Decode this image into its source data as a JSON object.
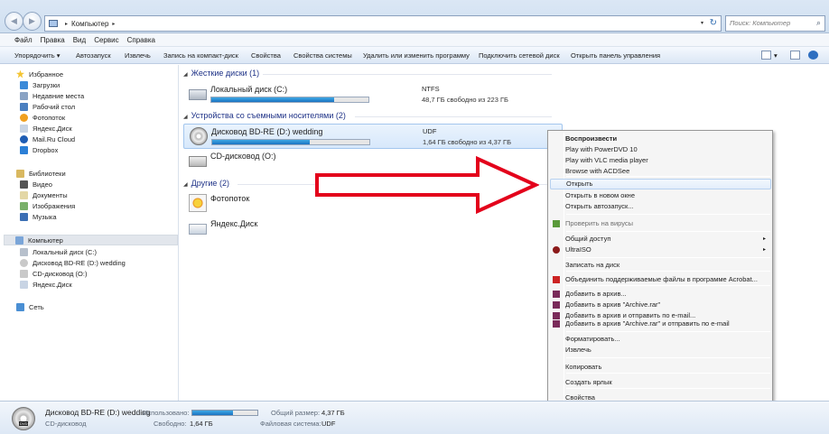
{
  "window": {
    "address": {
      "root_glyph": "▸",
      "crumb": "Компьютер",
      "dropdown_glyph": "▾",
      "refresh_glyph": "↻"
    },
    "search": {
      "placeholder": "Поиск: Компьютер",
      "icon": "search-icon"
    },
    "nav": {
      "back_glyph": "◀",
      "forward_glyph": "▶"
    }
  },
  "menubar": [
    "Файл",
    "Правка",
    "Вид",
    "Сервис",
    "Справка"
  ],
  "toolbar": {
    "organize": "Упорядочить ▾",
    "items": [
      "Автозапуск",
      "Извлечь",
      "Запись на компакт-диск",
      "Свойства",
      "Свойства системы",
      "Удалить или изменить программу",
      "Подключить сетевой диск",
      "Открыть панель управления"
    ],
    "view_glyph": "▾"
  },
  "sidebar": {
    "favorites": {
      "label": "Избранное",
      "items": [
        "Загрузки",
        "Недавние места",
        "Рабочий стол",
        "Фотопоток",
        "Яндекс.Диск",
        "Mail.Ru Cloud",
        "Dropbox"
      ]
    },
    "libraries": {
      "label": "Библиотеки",
      "items": [
        "Видео",
        "Документы",
        "Изображения",
        "Музыка"
      ]
    },
    "computer": {
      "label": "Компьютер",
      "items": [
        "Локальный диск (C:)",
        "Дисковод BD-RE (D:) wedding",
        "CD-дисковод (O:)",
        "Яндекс.Диск"
      ]
    },
    "network": {
      "label": "Сеть"
    }
  },
  "content": {
    "groups": {
      "hdd": "Жесткие диски (1)",
      "removable": "Устройства со съемными носителями (2)",
      "other": "Другие (2)"
    },
    "drives": {
      "c": {
        "name": "Локальный диск (C:)",
        "fs": "NTFS",
        "free": "48,7 ГБ свободно из 223 ГБ",
        "used_fraction": 0.78
      },
      "d": {
        "name": "Дисковод BD-RE (D:) wedding",
        "fs": "UDF",
        "free": "1,64 ГБ свободно из 4,37 ГБ",
        "used_fraction": 0.62
      },
      "o": {
        "name": "CD-дисковод (O:)"
      }
    },
    "other": [
      "Фотопоток",
      "Яндекс.Диск"
    ]
  },
  "context_menu": {
    "items": [
      {
        "label": "Воспроизвести",
        "bold": true
      },
      {
        "label": "Play with PowerDVD 10"
      },
      {
        "label": "Play with VLC media player"
      },
      {
        "label": "Browse with ACDSee"
      },
      {
        "label": "Открыть",
        "hover": true
      },
      {
        "label": "Открыть в новом окне"
      },
      {
        "label": "Открыть автозапуск..."
      },
      {
        "label": "Проверить на вирусы",
        "disabled": true
      },
      {
        "label": "Общий доступ",
        "submenu": true
      },
      {
        "label": "UltraISO",
        "submenu": true
      },
      {
        "label": "Записать на диск"
      },
      {
        "label": "Объединить поддерживаемые файлы в программе Acrobat..."
      },
      {
        "label": "Добавить в архив..."
      },
      {
        "label": "Добавить в архив \"Archive.rar\""
      },
      {
        "label": "Добавить в архив и отправить по e-mail..."
      },
      {
        "label": "Добавить в архив \"Archive.rar\" и отправить по e-mail"
      },
      {
        "label": "Форматировать..."
      },
      {
        "label": "Извлечь"
      },
      {
        "label": "Копировать"
      },
      {
        "label": "Создать ярлык"
      },
      {
        "label": "Свойства"
      }
    ],
    "submenu_glyph": "▸"
  },
  "details": {
    "name": "Дисковод BD-RE (D:) wedding",
    "type": "CD-дисковод",
    "used_label": "Использовано:",
    "used_fraction": 0.62,
    "free_label": "Свободно:",
    "free_value": "1,64 ГБ",
    "total_label": "Общий размер:",
    "total_value": "4,37 ГБ",
    "fs_label": "Файловая система:",
    "fs_value": "UDF",
    "badge": "DVD"
  },
  "colors": {
    "accent": "#1a73c2",
    "arrow": "#e3001b",
    "selection": "#d7e8fb",
    "group_header": "#1e3287"
  }
}
